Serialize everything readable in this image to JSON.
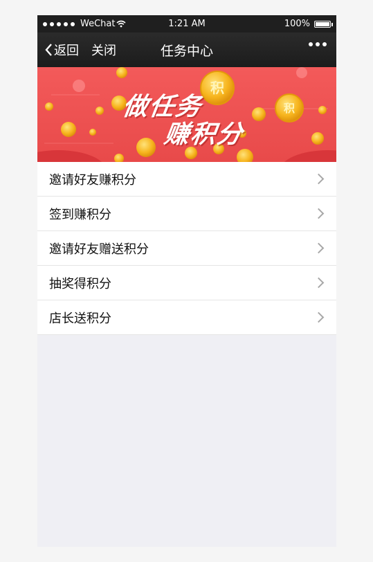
{
  "statusbar": {
    "carrier": "WeChat",
    "time": "1:21 AM",
    "battery": "100%"
  },
  "navbar": {
    "back_label": "返回",
    "close_label": "关闭",
    "title": "任务中心"
  },
  "banner": {
    "line1": "做任务",
    "line2": "赚积分",
    "coin_char": "积"
  },
  "tasks": [
    {
      "label": "邀请好友赚积分"
    },
    {
      "label": "签到赚积分"
    },
    {
      "label": "邀请好友赠送积分"
    },
    {
      "label": "抽奖得积分"
    },
    {
      "label": "店长送积分"
    }
  ],
  "colors": {
    "banner_red": "#ef4f4f",
    "coin_gold": "#f7b51e",
    "navbar": "#1f1f1f"
  }
}
